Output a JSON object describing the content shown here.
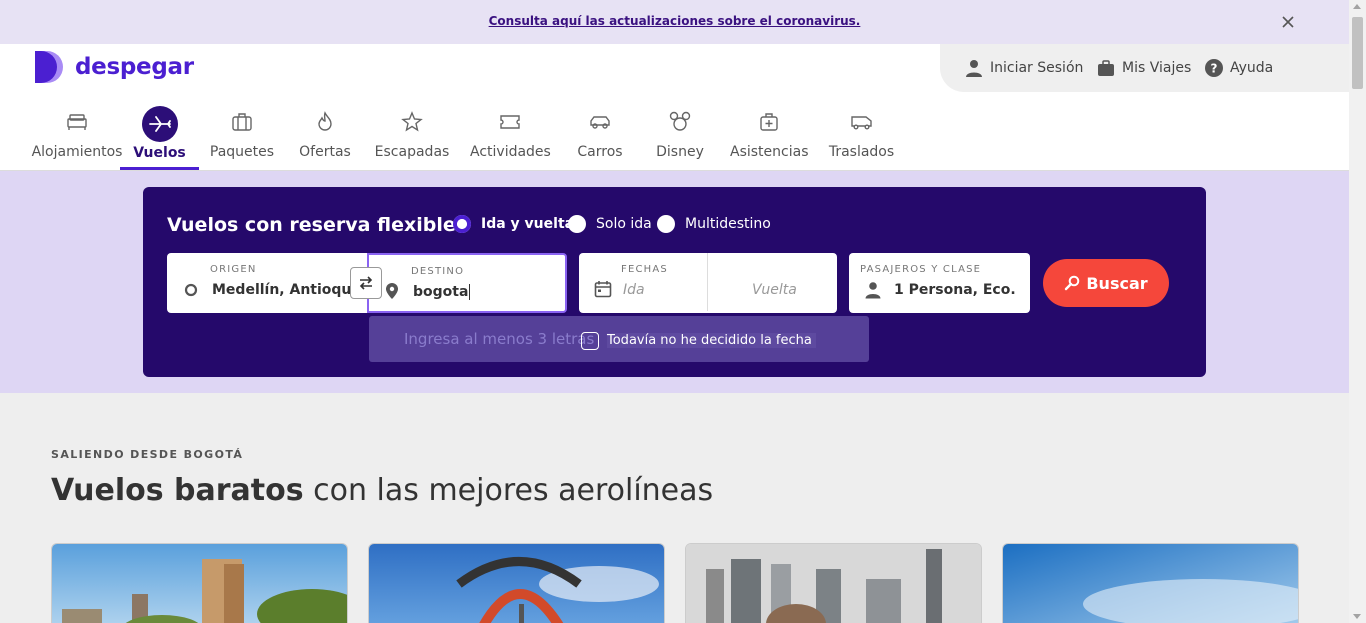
{
  "alert": {
    "text": "Consulta aquí las actualizaciones sobre el coronavirus."
  },
  "brand": {
    "name": "despegar",
    "color": "#4b1fd1"
  },
  "user_menu": [
    {
      "label": "Iniciar Sesión",
      "icon": "user-icon"
    },
    {
      "label": "Mis Viajes",
      "icon": "briefcase-icon"
    },
    {
      "label": "Ayuda",
      "icon": "help-icon"
    }
  ],
  "nav": [
    {
      "label": "Alojamientos",
      "icon": "bed-icon"
    },
    {
      "label": "Vuelos",
      "icon": "plane-icon",
      "active": true
    },
    {
      "label": "Paquetes",
      "icon": "suitcase-icon"
    },
    {
      "label": "Ofertas",
      "icon": "flame-icon"
    },
    {
      "label": "Escapadas",
      "icon": "star-icon"
    },
    {
      "label": "Actividades",
      "icon": "ticket-icon"
    },
    {
      "label": "Carros",
      "icon": "car-icon"
    },
    {
      "label": "Disney",
      "icon": "mickey-icon"
    },
    {
      "label": "Asistencias",
      "icon": "medkit-icon"
    },
    {
      "label": "Traslados",
      "icon": "bus-icon"
    }
  ],
  "search": {
    "title": "Vuelos con reserva flexible",
    "trip_types": [
      {
        "label": "Ida y vuelta",
        "checked": true
      },
      {
        "label": "Solo ida",
        "checked": false
      },
      {
        "label": "Multidestino",
        "checked": false
      }
    ],
    "origin": {
      "caption": "ORIGEN",
      "value": "Medellín, Antioqui..."
    },
    "destination": {
      "caption": "DESTINO",
      "value": "bogota"
    },
    "dates": {
      "caption": "FECHAS",
      "departure_placeholder": "Ida",
      "return_placeholder": "Vuelta"
    },
    "passengers": {
      "caption": "PASAJEROS Y CLASE",
      "value": "1 Persona, Eco..."
    },
    "submit_label": "Buscar",
    "dropdown_hint": "Ingresa al menos 3 letras",
    "undecided_label": "Todavía no he decidido la fecha"
  },
  "section": {
    "eyebrow": "SALIENDO DESDE BOGOTÁ",
    "headline_bold": "Vuelos baratos",
    "headline_rest": " con las mejores aerolíneas"
  },
  "colors": {
    "primary_dark": "#25096b",
    "accent": "#f5473b",
    "band": "#ded6f4"
  }
}
